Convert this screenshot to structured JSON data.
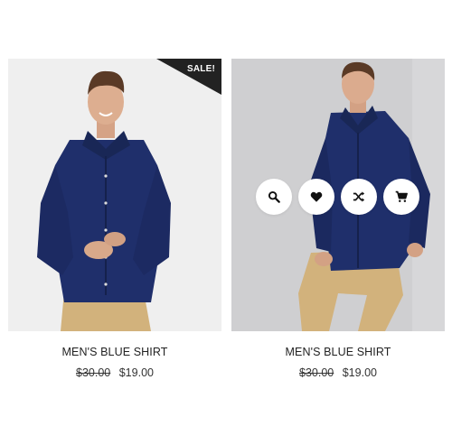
{
  "products": [
    {
      "title": "MEN'S BLUE SHIRT",
      "old_price": "$30.00",
      "new_price": "$19.00",
      "badge": "SALE!"
    },
    {
      "title": "MEN'S BLUE SHIRT",
      "old_price": "$30.00",
      "new_price": "$19.00",
      "actions": [
        "search-icon",
        "heart-icon",
        "shuffle-icon",
        "cart-icon"
      ]
    }
  ],
  "colors": {
    "shirt": "#1f2f6b",
    "pants": "#d2b27c",
    "badge_bg": "#222222",
    "hover_bg": "#cfcfd1"
  }
}
